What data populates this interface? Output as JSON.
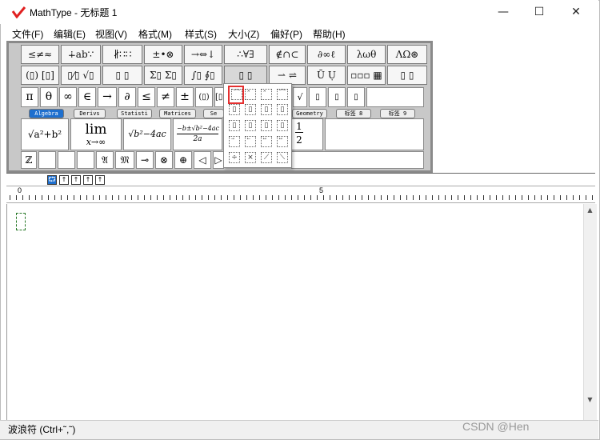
{
  "window": {
    "title": "MathType - 无标题 1",
    "controls": {
      "minimize": "—",
      "maximize": "☐",
      "close": "✕"
    }
  },
  "menu": [
    {
      "label": "文件(F)"
    },
    {
      "label": "编辑(E)"
    },
    {
      "label": "视图(V)"
    },
    {
      "label": "格式(M)"
    },
    {
      "label": "样式(S)"
    },
    {
      "label": "大小(Z)"
    },
    {
      "label": "偏好(P)"
    },
    {
      "label": "帮助(H)"
    }
  ],
  "palette_row1": [
    "≤≠≈",
    "∔ab∵",
    "∦∷∷",
    "±•⊗",
    "→⇔↓",
    "∴∀∃",
    "∉∩⊂",
    "∂∞ℓ",
    "λωθ",
    "ΛΩ⊛"
  ],
  "palette_row2": [
    "(▯) [▯]",
    "▯⁄▯ √▯",
    "▯ ▯",
    "Σ▯ Σ▯",
    "∫▯ ∮▯",
    "▯ ▯",
    "⇀ ⇌",
    "Ū Ụ",
    "▫▫▫ ▦",
    "▯ ▯"
  ],
  "symbols_row": [
    "π",
    "θ",
    "∞",
    "∈",
    "→",
    "∂",
    "≤",
    "≠",
    "±",
    "(▯)",
    "[▯]",
    "√",
    "▯",
    "▯",
    "▯"
  ],
  "tabs": [
    {
      "label": "Algebra",
      "selected": true
    },
    {
      "label": "Derivs"
    },
    {
      "label": "Statisti"
    },
    {
      "label": "Matrices"
    },
    {
      "label": "Se"
    },
    {
      "label": "Geometry"
    },
    {
      "label": "标签 8"
    },
    {
      "label": "标签 9"
    }
  ],
  "templates": {
    "pythag": "√a²+b²",
    "limit_top": "lim",
    "limit_bottom": "x→∞",
    "discriminant": "√b²−4ac",
    "quadratic_num": "−b±√b²−4ac",
    "quadratic_den": "2a",
    "fraction_num": "1",
    "fraction_den": "2"
  },
  "bottom_row": [
    "ℤ",
    "",
    "",
    "",
    "𝔄",
    "𝔐",
    "⊸",
    "⊗",
    "⊕",
    "◁",
    "▷"
  ],
  "dropdown_items": [
    "⁀",
    "̂",
    "̂",
    "⁀",
    "▯",
    "▯",
    "▯",
    "▯",
    "▯",
    "▯",
    "▯",
    "▯",
    "⃗",
    "⃖",
    "⃡",
    "⃡",
    "⃗",
    "⃖",
    "⃡",
    "⃡",
    "÷",
    "⨯",
    "⟋",
    "⟍"
  ],
  "tab_buttons": [
    "⮔",
    "↑",
    "↑",
    "↑",
    "↑"
  ],
  "ruler": {
    "start": "0",
    "mark": "5"
  },
  "status": {
    "text": "波浪符 (Ctrl+˜,˜)"
  },
  "watermark": "CSDN @Hen"
}
